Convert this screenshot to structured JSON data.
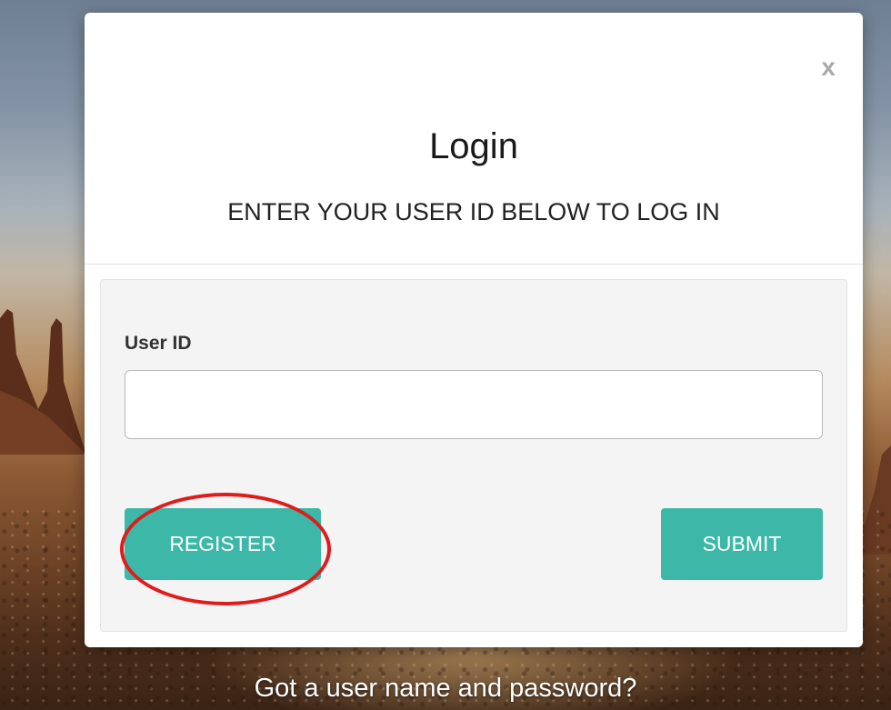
{
  "modal": {
    "close_label": "x",
    "title": "Login",
    "subtitle": "ENTER YOUR USER ID BELOW TO LOG IN"
  },
  "form": {
    "user_id_label": "User ID",
    "user_id_value": "",
    "user_id_placeholder": "",
    "register_label": "REGISTER",
    "submit_label": "SUBMIT"
  },
  "footer": {
    "text": "Got a user name and password?"
  },
  "colors": {
    "button_teal": "#3db8a8",
    "highlight_red": "#e11b1b"
  }
}
